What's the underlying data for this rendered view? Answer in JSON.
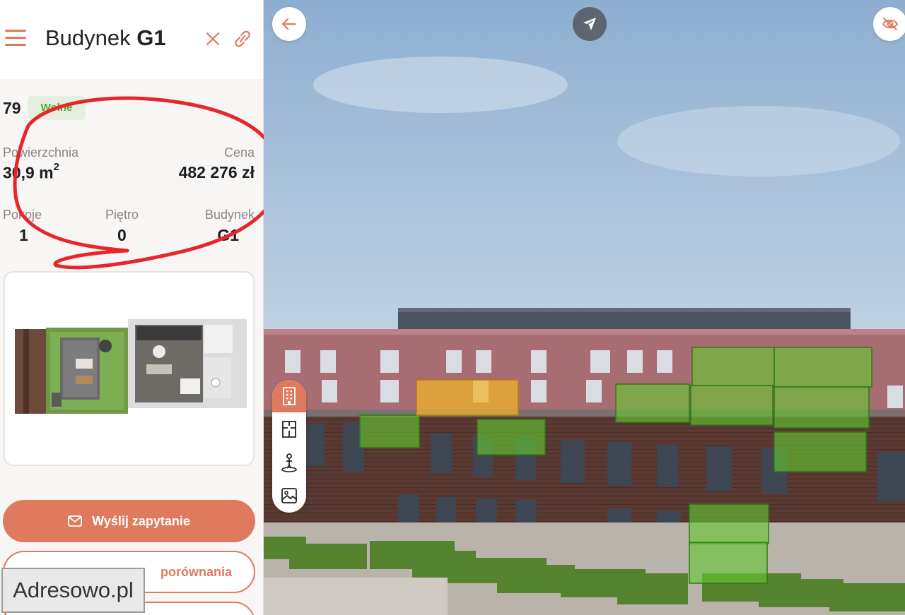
{
  "header": {
    "title_prefix": "Budynek",
    "title_building": "G1"
  },
  "apartment": {
    "number": "79",
    "status": "Wolne"
  },
  "details": {
    "area_label": "Powierzchnia",
    "area_value": "30,9 m",
    "area_unit_power": "2",
    "price_label": "Cena",
    "price_value": "482 276 zł",
    "rooms_label": "Pokoje",
    "rooms_value": "1",
    "floor_label": "Piętro",
    "floor_value": "0",
    "building_label": "Budynek",
    "building_value": "G1"
  },
  "actions": {
    "inquiry_label": "Wyślij zapytanie",
    "compare_label": "porównania"
  },
  "watermark": "Adresowo.pl",
  "icons": {
    "menu": "hamburger-menu-icon",
    "close": "close-icon",
    "link": "link-icon",
    "back": "arrow-left-icon",
    "compass": "compass-icon",
    "hide": "eye-off-icon",
    "building": "building-icon",
    "floor_plan": "floor-plan-icon",
    "walk": "person-pin-icon",
    "gallery": "image-icon",
    "mail": "mail-icon"
  },
  "colors": {
    "accent": "#e07a5f",
    "status_green": "#5aa03a",
    "status_bg": "#e4efdd",
    "available_highlight": "#64c832",
    "selected_highlight": "#f0b428",
    "annotation_red": "#e8262a"
  }
}
